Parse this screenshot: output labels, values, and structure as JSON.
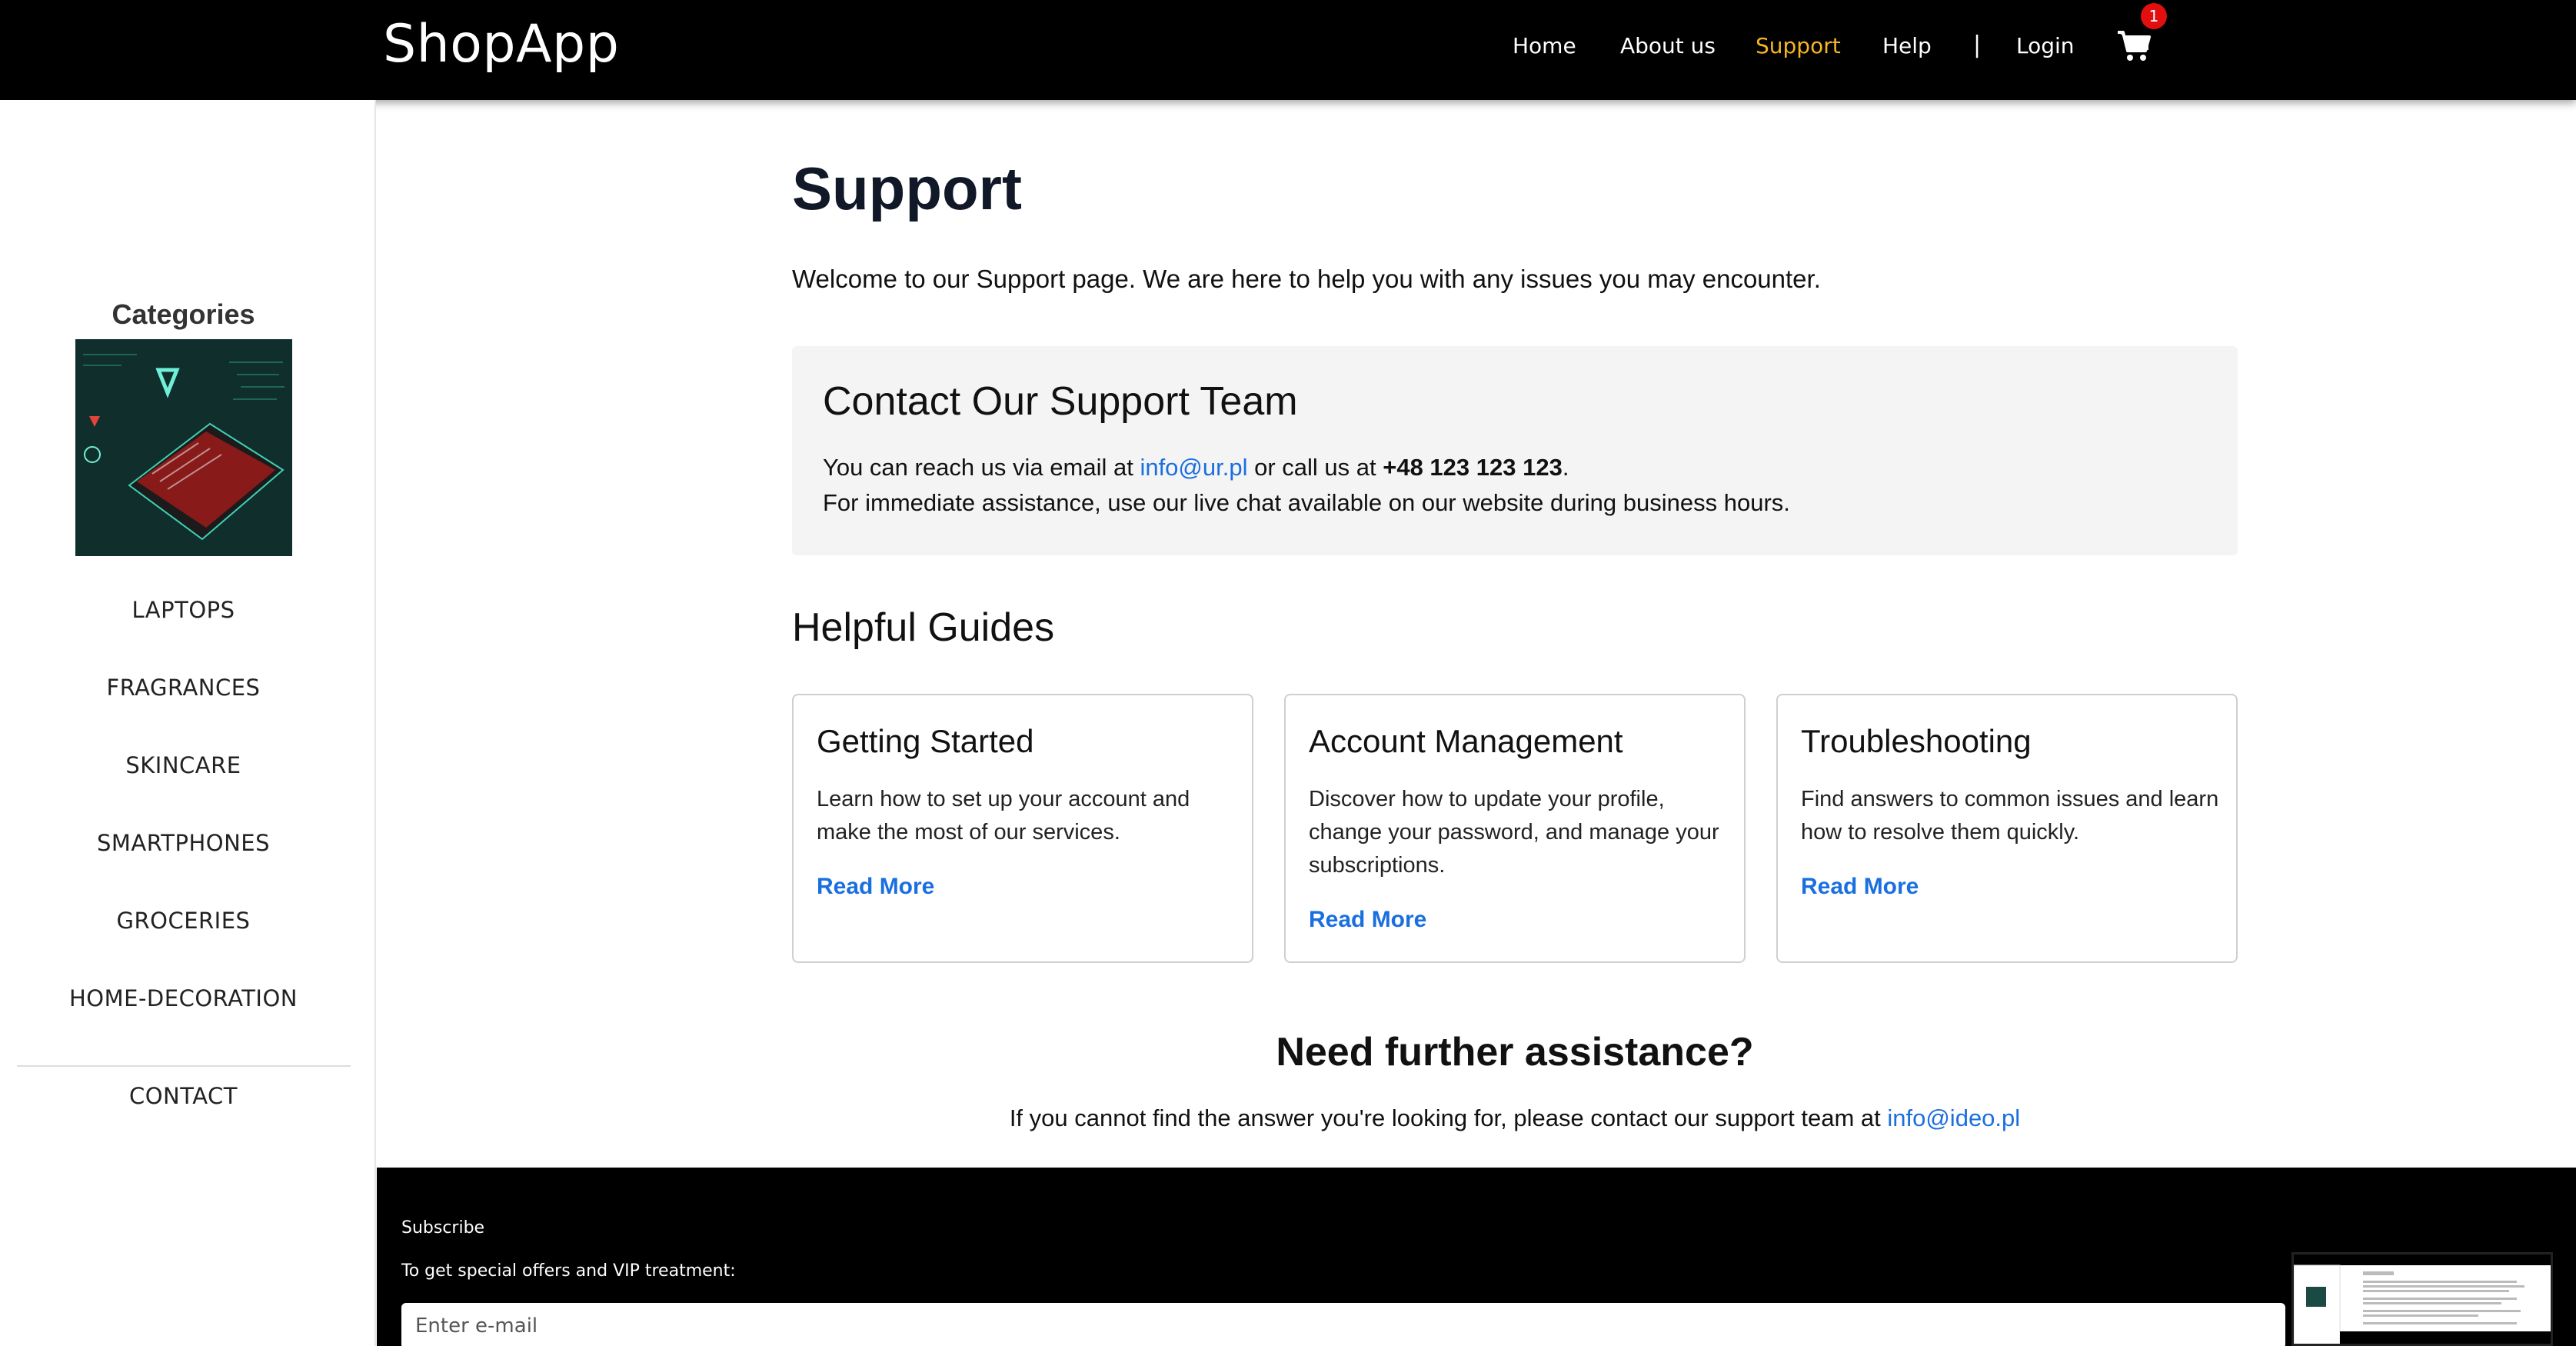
{
  "header": {
    "logo": "ShopApp",
    "nav": [
      {
        "label": "Home"
      },
      {
        "label": "About us"
      },
      {
        "label": "Support"
      },
      {
        "label": "Help"
      }
    ],
    "separator": "|",
    "login_label": "Login",
    "cart_count": "1",
    "active_color": "#f5b524"
  },
  "sidebar": {
    "title": "Categories",
    "image_alt_icon": "laptop-code-illustration",
    "categories": [
      "LAPTOPS",
      "FRAGRANCES",
      "SKINCARE",
      "SMARTPHONES",
      "GROCERIES",
      "HOME-DECORATION"
    ],
    "contact_label": "CONTACT"
  },
  "main": {
    "title": "Support",
    "intro": "Welcome to our Support page. We are here to help you with any issues you may encounter.",
    "contact": {
      "heading": "Contact Our Support Team",
      "text_before_email": "You can reach us via email at ",
      "email": "info@ur.pl",
      "text_before_phone": " or call us at ",
      "phone": "+48 123 123 123",
      "text_after_phone": ".",
      "line2": "For immediate assistance, use our live chat available on our website during business hours."
    },
    "guides_title": "Helpful Guides",
    "guides": [
      {
        "title": "Getting Started",
        "text": "Learn how to set up your account and make the most of our services.",
        "link": "Read More"
      },
      {
        "title": "Account Management",
        "text": "Discover how to update your profile, change your password, and manage your subscriptions.",
        "link": "Read More"
      },
      {
        "title": "Troubleshooting",
        "text": "Find answers to common issues and learn how to resolve them quickly.",
        "link": "Read More"
      }
    ],
    "further": {
      "title": "Need further assistance?",
      "text": "If you cannot find the answer you're looking for, please contact our support team at ",
      "email": "info@ideo.pl"
    }
  },
  "footer": {
    "subscribe_title": "Subscribe",
    "subscribe_text": "To get special offers and VIP treatment:",
    "email_placeholder": "Enter e-mail"
  },
  "colors": {
    "link": "#1a6fe0",
    "badge": "#e10f0f",
    "header_bg": "#000000"
  }
}
